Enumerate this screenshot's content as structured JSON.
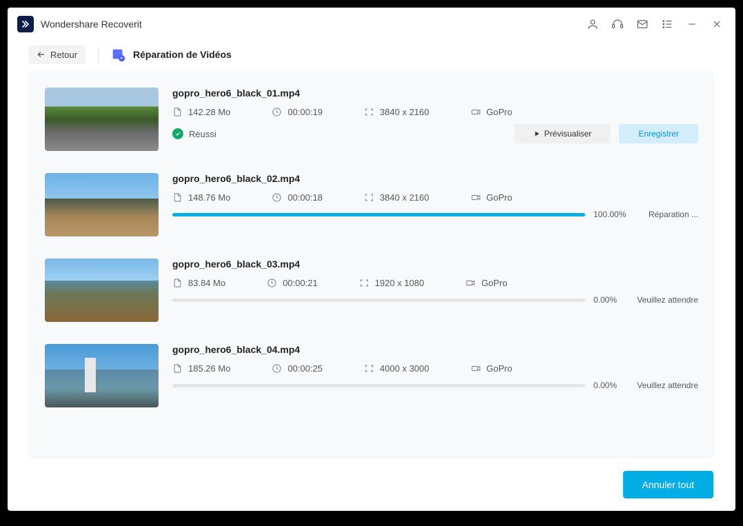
{
  "app": {
    "title": "Wondershare Recoverit"
  },
  "toolbar": {
    "back_label": "Retour",
    "section_title": "Réparation de Vidéos"
  },
  "videos": [
    {
      "name": "gopro_hero6_black_01.mp4",
      "size": "142.28 Mo",
      "duration": "00:00:19",
      "resolution": "3840 x 2160",
      "device": "GoPro",
      "status_type": "done",
      "status_label": "Réussi",
      "preview_label": "Prévisualiser",
      "save_label": "Enregistrer"
    },
    {
      "name": "gopro_hero6_black_02.mp4",
      "size": "148.76 Mo",
      "duration": "00:00:18",
      "resolution": "3840 x 2160",
      "device": "GoPro",
      "status_type": "progress",
      "progress_pct": "100.00%",
      "progress_label": "Réparation ...",
      "progress_fill": 100
    },
    {
      "name": "gopro_hero6_black_03.mp4",
      "size": "83.84 Mo",
      "duration": "00:00:21",
      "resolution": "1920 x 1080",
      "device": "GoPro",
      "status_type": "progress",
      "progress_pct": "0.00%",
      "progress_label": "Veuillez attendre",
      "progress_fill": 0
    },
    {
      "name": "gopro_hero6_black_04.mp4",
      "size": "185.26 Mo",
      "duration": "00:00:25",
      "resolution": "4000 x 3000",
      "device": "GoPro",
      "status_type": "progress",
      "progress_pct": "0.00%",
      "progress_label": "Veuillez attendre",
      "progress_fill": 0
    }
  ],
  "footer": {
    "cancel_all_label": "Annuler tout"
  }
}
